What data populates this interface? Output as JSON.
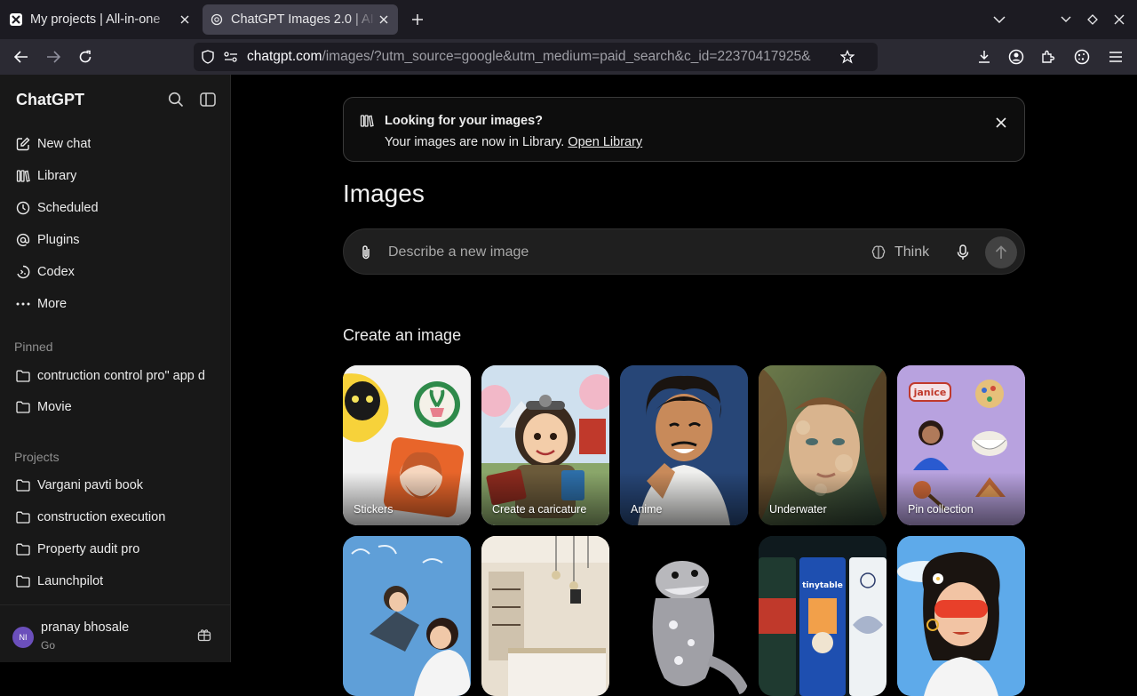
{
  "browser": {
    "tabs": [
      {
        "title": "My projects | All-in-one",
        "active": false
      },
      {
        "title": "ChatGPT Images 2.0 | AI",
        "active": true
      }
    ],
    "url_host": "chatgpt.com",
    "url_path": "/images/?utm_source=google&utm_medium=paid_search&c_id=22370417925&"
  },
  "sidebar": {
    "brand": "ChatGPT",
    "nav": [
      {
        "label": "New chat",
        "icon": "compose-icon"
      },
      {
        "label": "Library",
        "icon": "library-icon"
      },
      {
        "label": "Scheduled",
        "icon": "clock-icon"
      },
      {
        "label": "Plugins",
        "icon": "at-icon"
      },
      {
        "label": "Codex",
        "icon": "codex-icon"
      },
      {
        "label": "More",
        "icon": "more-icon"
      }
    ],
    "pinned_heading": "Pinned",
    "pinned": [
      {
        "label": "contruction control pro\" app d"
      },
      {
        "label": "Movie"
      }
    ],
    "projects_heading": "Projects",
    "projects": [
      {
        "label": "Vargani pavti book"
      },
      {
        "label": "construction execution"
      },
      {
        "label": "Property audit pro"
      },
      {
        "label": "Launchpilot"
      }
    ],
    "user": {
      "initials": "NI",
      "name": "pranay bhosale",
      "plan": "Go"
    }
  },
  "banner": {
    "title": "Looking for your images?",
    "text": "Your images are now in Library.",
    "link": "Open Library"
  },
  "main": {
    "title": "Images",
    "composer": {
      "placeholder": "Describe a new image",
      "think_label": "Think"
    },
    "section_title": "Create an image",
    "cards": [
      {
        "label": "Stickers"
      },
      {
        "label": "Create a caricature"
      },
      {
        "label": "Anime"
      },
      {
        "label": "Underwater"
      },
      {
        "label": "Pin collection"
      },
      {
        "label": ""
      },
      {
        "label": ""
      },
      {
        "label": ""
      },
      {
        "label": ""
      },
      {
        "label": ""
      }
    ]
  },
  "colors": {
    "accent": "#6b4fbb",
    "background": "#000000",
    "sidebar": "#181818"
  }
}
